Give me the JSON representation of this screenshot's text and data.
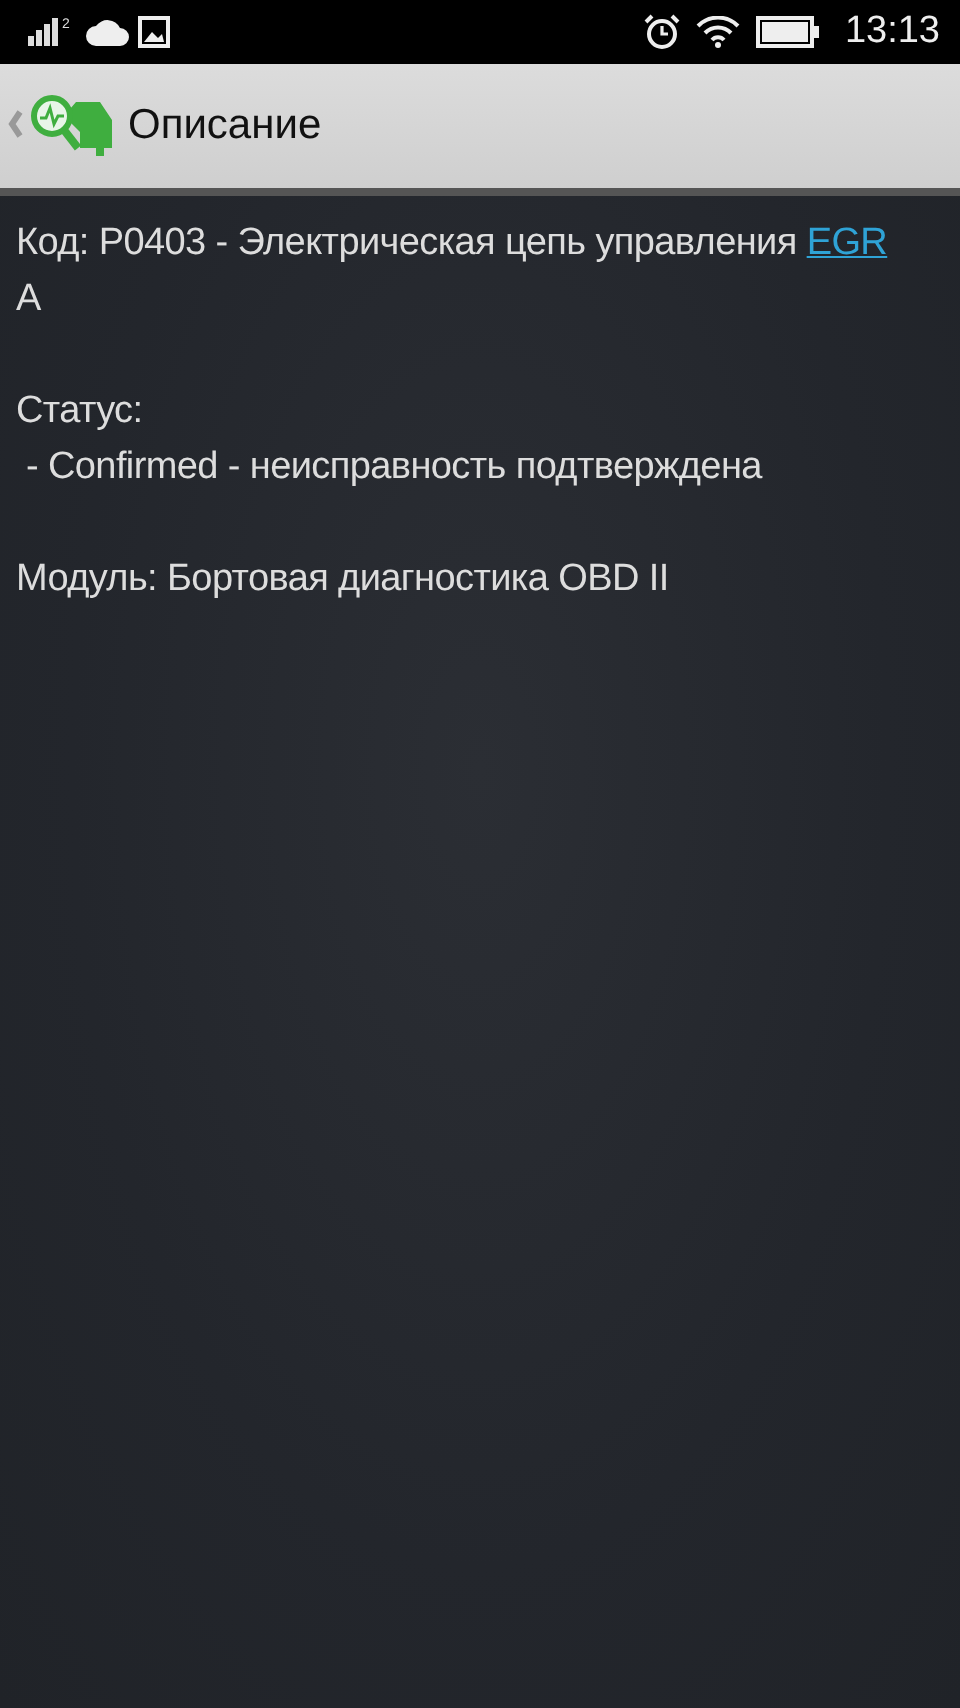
{
  "status_bar": {
    "sim": "2",
    "time": "13:13"
  },
  "app_bar": {
    "title": "Описание"
  },
  "code": {
    "text": "Код: P0403 - Электрическая цепь управления",
    "link": "EGR",
    "suffix": "A"
  },
  "status": {
    "label": "Статус:",
    "value": " - Confirmed - неисправность подтверждена"
  },
  "module": {
    "text": "Модуль: Бортовая диагностика OBD II"
  }
}
